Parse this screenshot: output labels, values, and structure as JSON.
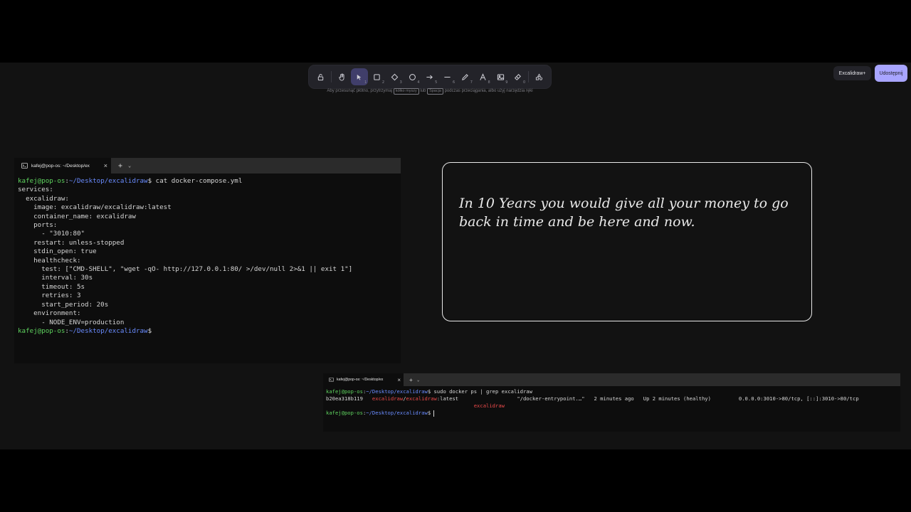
{
  "toolbar": {
    "tools": [
      {
        "icon": "lock-icon",
        "num": ""
      },
      {
        "icon": "hand-icon",
        "num": ""
      },
      {
        "icon": "selection-arrow-icon",
        "num": "1",
        "active": true
      },
      {
        "icon": "rectangle-icon",
        "num": "2"
      },
      {
        "icon": "diamond-icon",
        "num": "3"
      },
      {
        "icon": "ellipse-icon",
        "num": "4"
      },
      {
        "icon": "arrow-icon",
        "num": "5"
      },
      {
        "icon": "line-icon",
        "num": "6"
      },
      {
        "icon": "pencil-icon",
        "num": "7"
      },
      {
        "icon": "text-icon",
        "num": "8"
      },
      {
        "icon": "image-icon",
        "num": "9"
      },
      {
        "icon": "eraser-icon",
        "num": "0"
      },
      {
        "icon": "shapes-library-icon",
        "num": ""
      }
    ],
    "hint_before": "Aby przesunąć płótno, przytrzymaj",
    "hint_key1": "kółko myszy",
    "hint_mid": "lub",
    "hint_key2": "Spacja",
    "hint_after": "podczas przeciągania, albo użyj narzędzia ręki"
  },
  "header": {
    "excalidraw_plus": "Excalidraw+",
    "share": "Udostępnij"
  },
  "card": {
    "text": "In 10 Years you would give all your money to go back in time and be here and now."
  },
  "terminal1": {
    "tab_title": "kafej@pop-os: ~/Desktop/ex",
    "user": "kafej@pop-os",
    "sep": ":",
    "path": "~/Desktop/excalidraw",
    "prompt": "$",
    "command": " cat docker-compose.yml",
    "output": [
      "services:",
      "",
      "  excalidraw:",
      "    image: excalidraw/excalidraw:latest",
      "    container_name: excalidraw",
      "    ports:",
      "      - \"3010:80\"",
      "    restart: unless-stopped",
      "    stdin_open: true",
      "    healthcheck:",
      "      test: [\"CMD-SHELL\", \"wget -qO- http://127.0.0.1:80/ >/dev/null 2>&1 || exit 1\"]",
      "      interval: 30s",
      "      timeout: 5s",
      "      retries: 3",
      "      start_period: 20s",
      "    environment:",
      "      - NODE_ENV=production"
    ]
  },
  "terminal2": {
    "tab_title": "kafej@pop-os: ~/Desktop/ex",
    "user": "kafej@pop-os",
    "sep": ":",
    "path": "~/Desktop/excalidraw",
    "prompt": "$",
    "command": " sudo docker ps | grep excalidraw",
    "row_id": "b20ea318b119   ",
    "row_image_a": "excalidraw",
    "row_image_slash": "/",
    "row_image_b": "excalidraw",
    "row_image_c": ":latest",
    "row_rest": "                   \"/docker-entrypoint.…\"   2 minutes ago   Up 2 minutes (healthy)         0.0.0.0:3010->80/tcp, [::]:3010->80/tcp",
    "row2_pad": "                                                ",
    "row2_name": "excalidraw"
  }
}
